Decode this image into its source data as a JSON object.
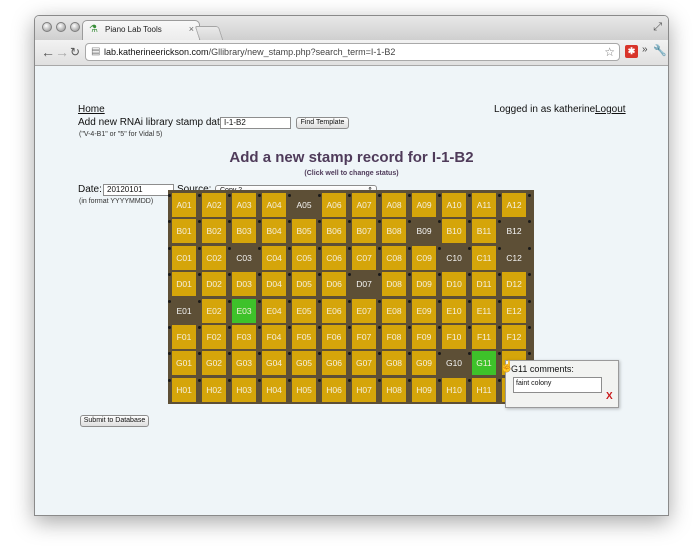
{
  "browser": {
    "tab_title": "Piano Lab Tools",
    "tab_icon": "flask-icon",
    "url_host": "lab.katherineerickson.com",
    "url_path": "/Gllibrary/new_stamp.php?search_term=I-1-B2",
    "extension_label": "✱"
  },
  "header": {
    "home_link": "Home",
    "logged_in_text": "Logged in as katherine",
    "logout_link": "Logout",
    "add_label": "Add new RNAi library stamp data:",
    "search_value": "I-1-B2",
    "find_button": "Find Template",
    "search_hint": "(\"V-4-B1\" or \"5\" for Vidal 5)"
  },
  "page": {
    "title": "Add a new stamp record for I-1-B2",
    "subtitle": "(Click well to change status)",
    "date_label": "Date:",
    "date_value": "20120101",
    "date_hint": "(in format YYYYMMDD)",
    "source_label": "Source:",
    "source_value": "Copy 2",
    "submit_button": "Submit to Database"
  },
  "plate": {
    "rows": [
      "A",
      "B",
      "C",
      "D",
      "E",
      "F",
      "G",
      "H"
    ],
    "cols": [
      "01",
      "02",
      "03",
      "04",
      "05",
      "06",
      "07",
      "08",
      "09",
      "10",
      "11",
      "12"
    ],
    "colors": {
      "yellow": "#d5a50a",
      "green": "#3ec22a",
      "plate": "#5d4f36"
    },
    "wells": {
      "A": [
        "yellow",
        "yellow",
        "yellow",
        "yellow",
        "empty",
        "yellow",
        "yellow",
        "yellow",
        "yellow",
        "yellow",
        "yellow",
        "yellow"
      ],
      "B": [
        "yellow",
        "yellow",
        "yellow",
        "yellow",
        "yellow",
        "yellow",
        "yellow",
        "yellow",
        "empty",
        "yellow",
        "yellow",
        "empty"
      ],
      "C": [
        "yellow",
        "yellow",
        "empty",
        "yellow",
        "yellow",
        "yellow",
        "yellow",
        "yellow",
        "yellow",
        "empty",
        "yellow",
        "empty"
      ],
      "D": [
        "yellow",
        "yellow",
        "yellow",
        "yellow",
        "yellow",
        "yellow",
        "empty",
        "yellow",
        "yellow",
        "yellow",
        "yellow",
        "yellow"
      ],
      "E": [
        "empty",
        "yellow",
        "green",
        "yellow",
        "yellow",
        "yellow",
        "yellow",
        "yellow",
        "yellow",
        "yellow",
        "yellow",
        "yellow"
      ],
      "F": [
        "yellow",
        "yellow",
        "yellow",
        "yellow",
        "yellow",
        "yellow",
        "yellow",
        "yellow",
        "yellow",
        "yellow",
        "yellow",
        "yellow"
      ],
      "G": [
        "yellow",
        "yellow",
        "yellow",
        "yellow",
        "yellow",
        "yellow",
        "yellow",
        "yellow",
        "yellow",
        "empty",
        "green",
        "yellow"
      ],
      "H": [
        "yellow",
        "yellow",
        "yellow",
        "yellow",
        "yellow",
        "yellow",
        "yellow",
        "yellow",
        "yellow",
        "yellow",
        "yellow",
        "yellow"
      ]
    }
  },
  "comment_popup": {
    "label": "G11 comments:",
    "text": "faint colony",
    "close": "X"
  }
}
